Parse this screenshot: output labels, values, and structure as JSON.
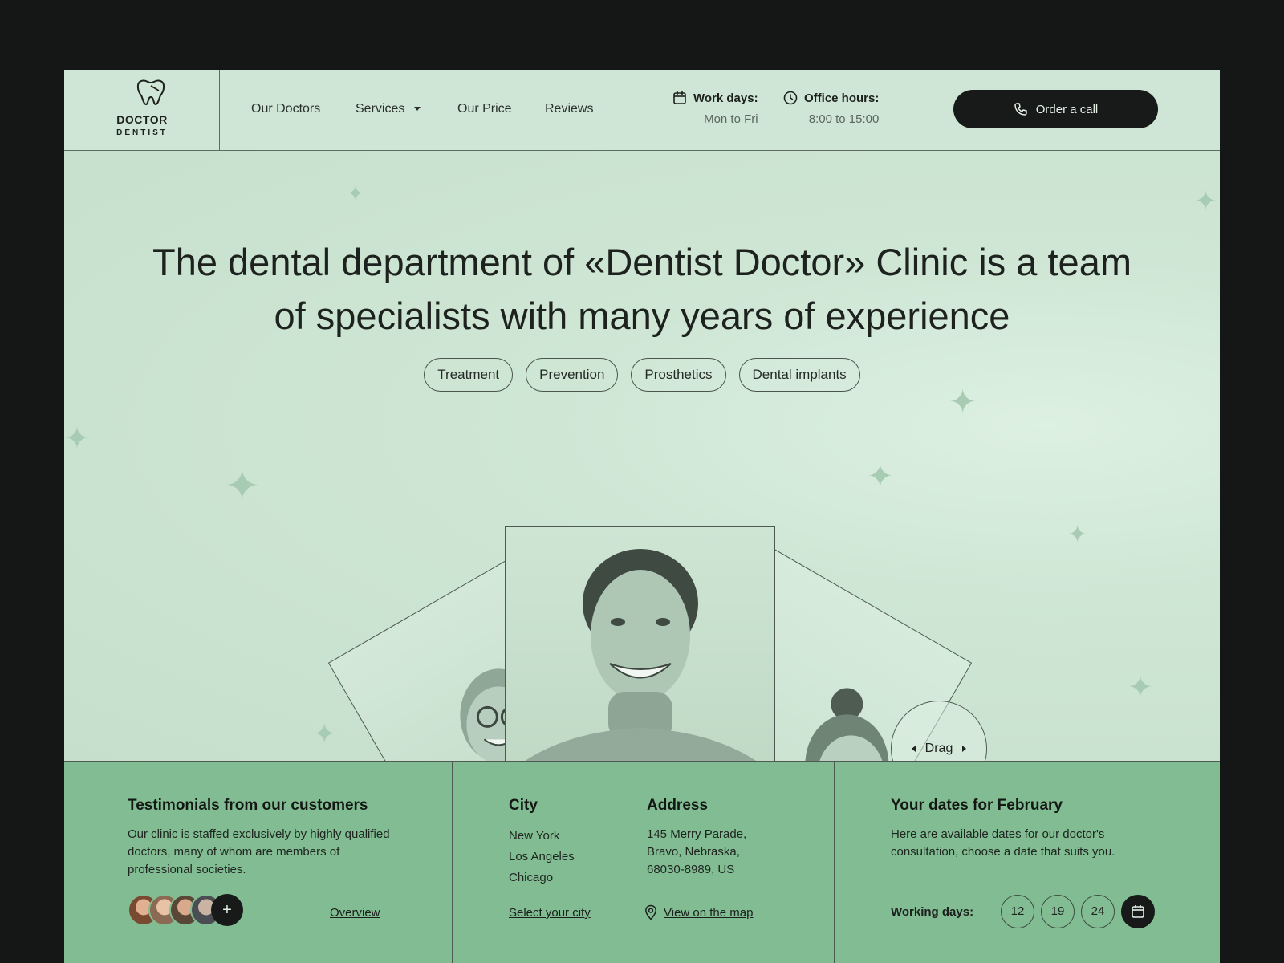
{
  "brand": {
    "name": "DOCTOR",
    "sub": "DENTIST"
  },
  "nav": {
    "doctors": "Our Doctors",
    "services": "Services",
    "price": "Our Price",
    "reviews": "Reviews"
  },
  "hours": {
    "workdays_label": "Work days:",
    "workdays_value": "Mon to Fri",
    "office_label": "Office hours:",
    "office_value": "8:00 to 15:00"
  },
  "cta": {
    "order": "Order a call"
  },
  "hero": {
    "headline_line1": "The dental department of «Dentist Doctor» Clinic is a team",
    "headline_line2": "of specialists with many years of experience",
    "tags": [
      "Treatment",
      "Prevention",
      "Prosthetics",
      "Dental implants"
    ],
    "drag": "Drag"
  },
  "testimonials": {
    "title": "Testimonials from our customers",
    "text": "Our clinic is staffed exclusively by highly qualified doctors, many of whom are members of professional societies.",
    "plus": "+",
    "overview": "Overview"
  },
  "location": {
    "city_title": "City",
    "cities": [
      "New York",
      "Los Angeles",
      "Chicago"
    ],
    "select_city": "Select your city",
    "address_title": "Address",
    "address_lines": [
      "145 Merry Parade,",
      "Bravo, Nebraska,",
      "68030-8989, US"
    ],
    "map_link": "View on the map"
  },
  "dates": {
    "title": "Your dates for February",
    "text": "Here are available dates for our doctor's consultation, choose a date that suits you.",
    "working_label": "Working days:",
    "days": [
      "12",
      "19",
      "24"
    ]
  },
  "colors": {
    "accent_green": "#82bc93",
    "hero_bg": "#cfe6d5",
    "dark": "#171a18"
  }
}
